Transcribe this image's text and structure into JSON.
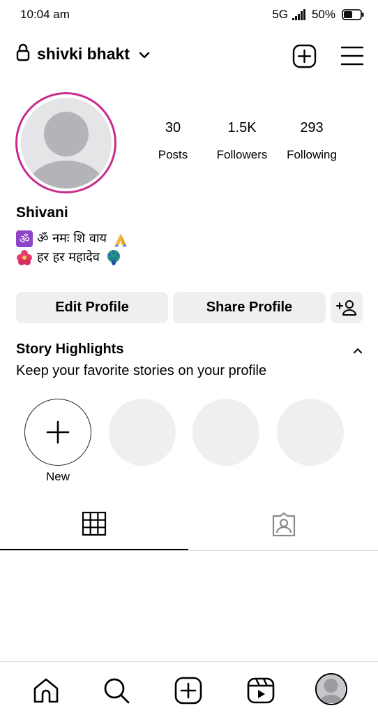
{
  "status_bar": {
    "time": "10:04 am",
    "network": "5G",
    "battery": "50%"
  },
  "header": {
    "username": "shivki bhakt"
  },
  "profile": {
    "stats": [
      {
        "value": "30",
        "label": "Posts"
      },
      {
        "value": "1.5K",
        "label": "Followers"
      },
      {
        "value": "293",
        "label": "Following"
      }
    ],
    "display_name": "Shivani",
    "bio": [
      {
        "text": "ॐ नमः शि वाय",
        "emoji_before": "om-symbol",
        "emoji_after": "folded-hands"
      },
      {
        "text": "हर हर महादेव",
        "emoji_before": "hibiscus",
        "emoji_after": "peacock"
      }
    ],
    "ring_color": "#c72b8c"
  },
  "buttons": {
    "edit": "Edit Profile",
    "share": "Share Profile"
  },
  "highlights": {
    "title": "Story Highlights",
    "subtitle": "Keep your favorite stories on your profile",
    "new_label": "New"
  },
  "icons": [
    "lock-icon",
    "chevron-down-icon",
    "new-post-icon",
    "menu-icon",
    "add-person-icon",
    "caret-up-icon",
    "grid-icon",
    "tagged-icon",
    "home-icon",
    "search-icon",
    "create-icon",
    "reels-icon"
  ]
}
